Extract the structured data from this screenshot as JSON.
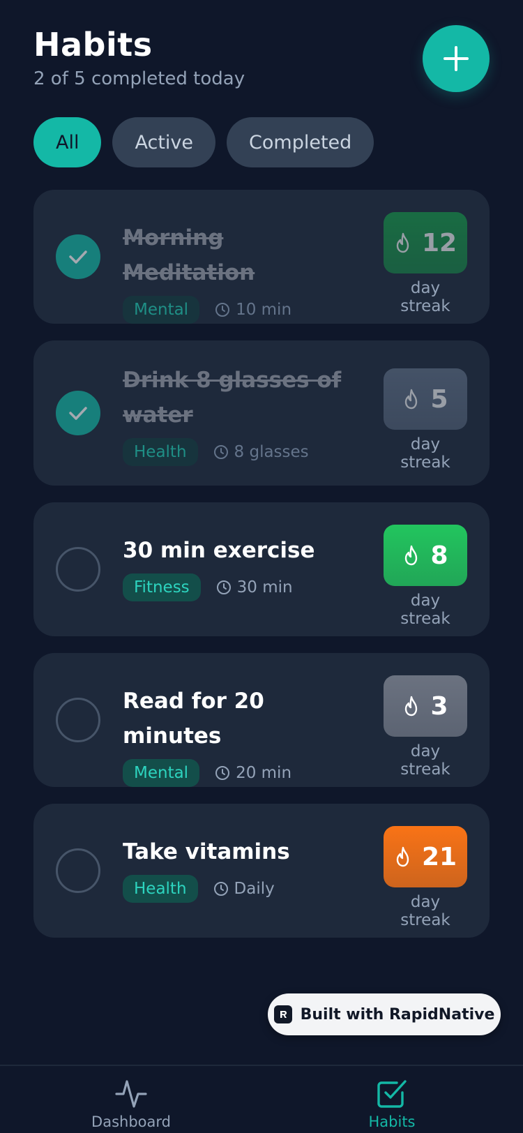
{
  "header": {
    "title": "Habits",
    "subtitle": "2 of 5 completed today"
  },
  "filters": [
    {
      "label": "All",
      "active": true
    },
    {
      "label": "Active",
      "active": false
    },
    {
      "label": "Completed",
      "active": false
    }
  ],
  "habits": [
    {
      "name": "Morning Meditation",
      "category": "Mental",
      "duration": "10 min",
      "completed": true,
      "streak": 12,
      "streak_color": "#16a34a"
    },
    {
      "name": "Drink 8 glasses of water",
      "category": "Health",
      "duration": "8 glasses",
      "completed": true,
      "streak": 5,
      "streak_color": "#64748b"
    },
    {
      "name": "30 min exercise",
      "category": "Fitness",
      "duration": "30 min",
      "completed": false,
      "streak": 8,
      "streak_color": "#22c55e"
    },
    {
      "name": "Read for 20 minutes",
      "category": "Mental",
      "duration": "20 min",
      "completed": false,
      "streak": 3,
      "streak_color": "#6b7280"
    },
    {
      "name": "Take vitamins",
      "category": "Health",
      "duration": "Daily",
      "completed": false,
      "streak": 21,
      "streak_color": "#f97316"
    }
  ],
  "streak_label": "day streak",
  "badge": {
    "text": "Built with RapidNative"
  },
  "tabs": [
    {
      "label": "Dashboard",
      "icon": "activity-icon",
      "active": false
    },
    {
      "label": "Habits",
      "icon": "check-square-icon",
      "active": true
    }
  ],
  "colors": {
    "accent": "#14b8a6",
    "background": "#0f172a",
    "card": "#1e293b"
  }
}
